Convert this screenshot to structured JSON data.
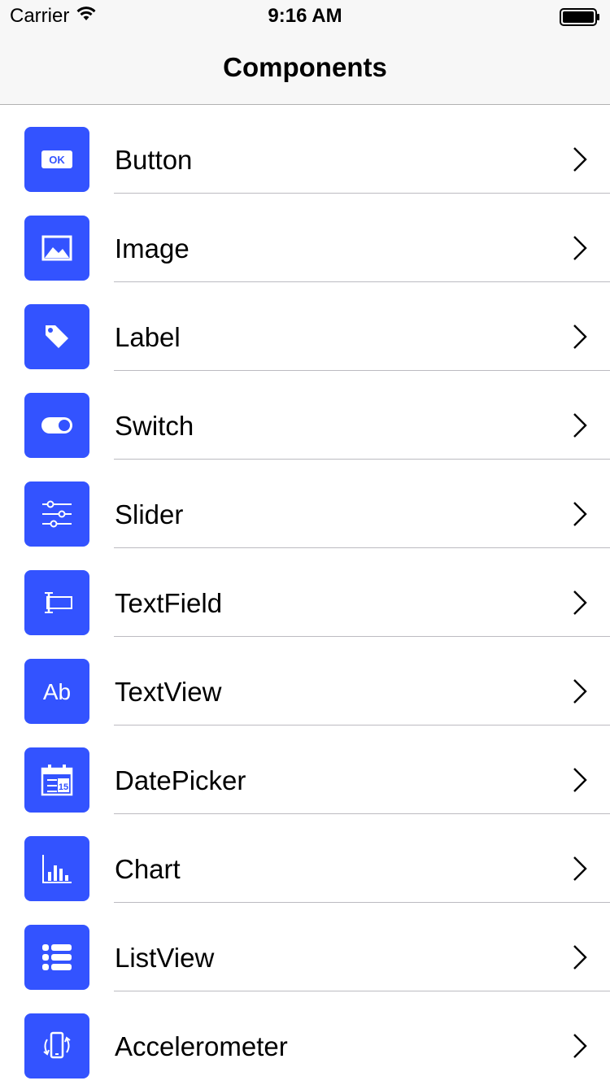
{
  "status_bar": {
    "carrier": "Carrier",
    "time": "9:16 AM"
  },
  "nav": {
    "title": "Components"
  },
  "accent_color": "#3353ff",
  "items": [
    {
      "label": "Button",
      "icon": "ok-button-icon"
    },
    {
      "label": "Image",
      "icon": "image-icon"
    },
    {
      "label": "Label",
      "icon": "tag-icon"
    },
    {
      "label": "Switch",
      "icon": "toggle-icon"
    },
    {
      "label": "Slider",
      "icon": "sliders-icon"
    },
    {
      "label": "TextField",
      "icon": "text-field-icon"
    },
    {
      "label": "TextView",
      "icon": "text-ab-icon"
    },
    {
      "label": "DatePicker",
      "icon": "calendar-icon"
    },
    {
      "label": "Chart",
      "icon": "bar-chart-icon"
    },
    {
      "label": "ListView",
      "icon": "list-icon"
    },
    {
      "label": "Accelerometer",
      "icon": "phone-rotate-icon"
    }
  ],
  "icon_texts": {
    "ok": "OK",
    "ab": "Ab",
    "calendar_day": "15"
  }
}
